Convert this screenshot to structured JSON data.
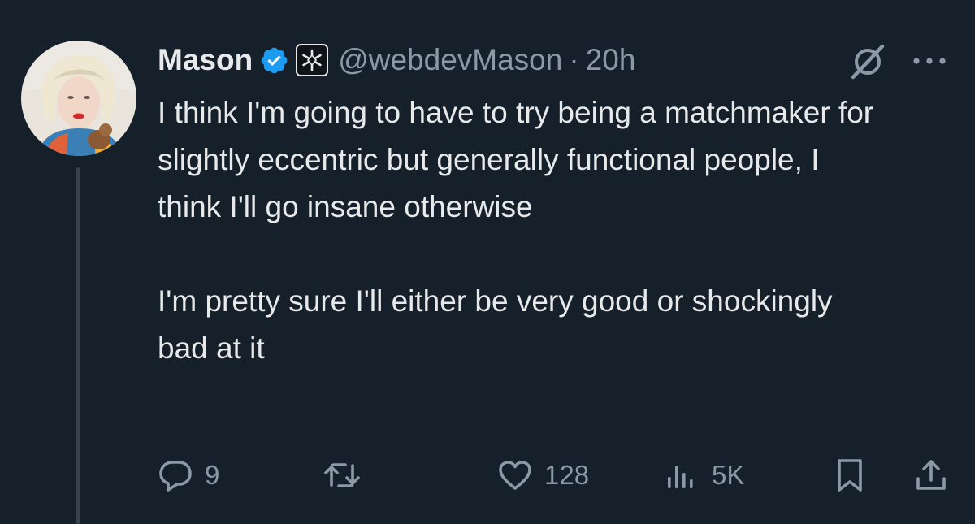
{
  "tweet": {
    "author": {
      "name": "Mason",
      "handle": "@webdevMason",
      "verified_icon": "verified-badge-icon",
      "affiliation_icon": "affiliate-badge-icon"
    },
    "separator": "·",
    "time": "20h",
    "text": [
      "I think I'm going to have to try being a matchmaker for slightly eccentric but generally functional people, I think I'll go insane otherwise",
      "I'm pretty sure I'll either be very good or shockingly bad at it"
    ],
    "actions": {
      "replies": "9",
      "retweets": "",
      "likes": "128",
      "views": "5K"
    },
    "icons": {
      "grok": "grok-icon",
      "more": "more-icon",
      "reply": "reply-icon",
      "retweet": "retweet-icon",
      "like": "heart-icon",
      "views": "views-icon",
      "bookmark": "bookmark-icon",
      "share": "share-icon"
    },
    "colors": {
      "background": "#15202b",
      "text": "#e7e9ea",
      "secondary": "#8b98a5",
      "verified": "#1d9bf0"
    }
  }
}
